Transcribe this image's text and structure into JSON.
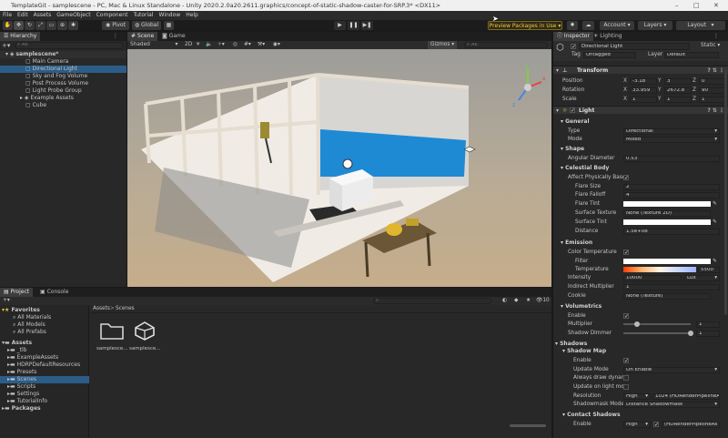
{
  "window": {
    "title": "TemplateGit - samplescene - PC, Mac & Linux Standalone - Unity 2020.2.0a20.2611.graphics/concept-of-static-shadow-caster-for-SRP.3* <DX11>"
  },
  "menu": [
    "File",
    "Edit",
    "Assets",
    "GameObject",
    "Component",
    "Tutorial",
    "Window",
    "Help"
  ],
  "toolbar": {
    "pivot": "Pivot",
    "global": "Global",
    "preview": "Preview Packages in Use",
    "account": "Account",
    "layers": "Layers",
    "layout": "Layout"
  },
  "hierarchy": {
    "tab": "Hierarchy",
    "search_placeholder": "All",
    "scene": "samplescene*",
    "items": [
      "Main Camera",
      "Directional Light",
      "Sky and Fog Volume",
      "Post Process Volume",
      "Light Probe Group",
      "Example Assets",
      "Cube"
    ]
  },
  "scene_view": {
    "tab_scene": "Scene",
    "tab_game": "Game",
    "shading": "Shaded",
    "mode_2d": "2D",
    "gizmos": "Gizmos",
    "search": "All",
    "gizmo_axis_x": "x",
    "gizmo_axis_y": "y",
    "gizmo_axis_z": "z"
  },
  "project": {
    "tab_project": "Project",
    "tab_console": "Console",
    "count": "10",
    "favorites_label": "Favorites",
    "favorites": [
      "All Materials",
      "All Models",
      "All Prefabs"
    ],
    "assets_label": "Assets",
    "assets": [
      "_tlb",
      "ExampleAssets",
      "HDRPDefaultResources",
      "Presets",
      "Scenes",
      "Scripts",
      "Settings",
      "TutorialInfo"
    ],
    "packages_label": "Packages",
    "breadcrumb_root": "Assets",
    "breadcrumb_current": "Scenes",
    "files": [
      "samplesce...",
      "samplesce..."
    ]
  },
  "inspector": {
    "tab_inspector": "Inspector",
    "tab_lighting": "Lighting",
    "object_name": "Directional Light",
    "static": "Static",
    "tag_label": "Tag",
    "tag": "Untagged",
    "layer_label": "Layer",
    "layer": "Default",
    "transform": {
      "title": "Transform",
      "position_label": "Position",
      "rotation_label": "Rotation",
      "scale_label": "Scale",
      "px": "-3.18",
      "py": "3",
      "pz": "0",
      "rx": "33.959",
      "ry": "2672.8",
      "rz": "90",
      "sx": "1",
      "sy": "1",
      "sz": "1"
    },
    "light": {
      "title": "Light",
      "general": "General",
      "type_label": "Type",
      "type": "Directional",
      "mode_label": "Mode",
      "mode": "Mixed",
      "shape": "Shape",
      "angular_label": "Angular Diameter",
      "angular": "0.53",
      "celestial": "Celestial Body",
      "affect_label": "Affect Physically Base",
      "flare_size_label": "Flare Size",
      "flare_size": "2",
      "flare_falloff_label": "Flare Falloff",
      "flare_falloff": "4",
      "flare_tint_label": "Flare Tint",
      "surface_texture_label": "Surface Texture",
      "surface_texture": "None (Texture 2D)",
      "surface_tint_label": "Surface Tint",
      "distance_label": "Distance",
      "distance": "1.5e+08",
      "emission": "Emission",
      "color_temp_label": "Color Temperature",
      "filter_label": "Filter",
      "temperature_label": "Temperature",
      "temperature": "5500",
      "intensity_label": "Intensity",
      "intensity": "10000",
      "intensity_unit": "Lux",
      "indirect_label": "Indirect Multiplier",
      "indirect": "1",
      "cookie_label": "Cookie",
      "cookie": "None (Texture)",
      "volumetrics": "Volumetrics",
      "enable_label": "Enable",
      "multiplier_label": "Multiplier",
      "multiplier": "1",
      "shadow_dimmer_label": "Shadow Dimmer",
      "shadow_dimmer": "1",
      "shadows": "Shadows",
      "shadow_map": "Shadow Map",
      "sm_enable_label": "Enable",
      "update_mode_label": "Update Mode",
      "update_mode": "On Enable",
      "always_draw_label": "Always draw dynami",
      "update_light_label": "Update on light mov",
      "resolution_label": "Resolution",
      "resolution": "High",
      "resolution_value": "1024 (HDRenderPipelineAs",
      "shadowmask_label": "Shadowmask Mode",
      "shadowmask": "Distance Shadowmask",
      "contact_shadows": "Contact Shadows",
      "cs_enable_label": "Enable",
      "cs_enable": "High",
      "cs_extra": "(HDRenderPipelineAs"
    }
  },
  "colors": {
    "accent": "#2c5d87",
    "panel": "#282828",
    "bg": "#191919",
    "wall_blue": "#1f8ad4"
  }
}
